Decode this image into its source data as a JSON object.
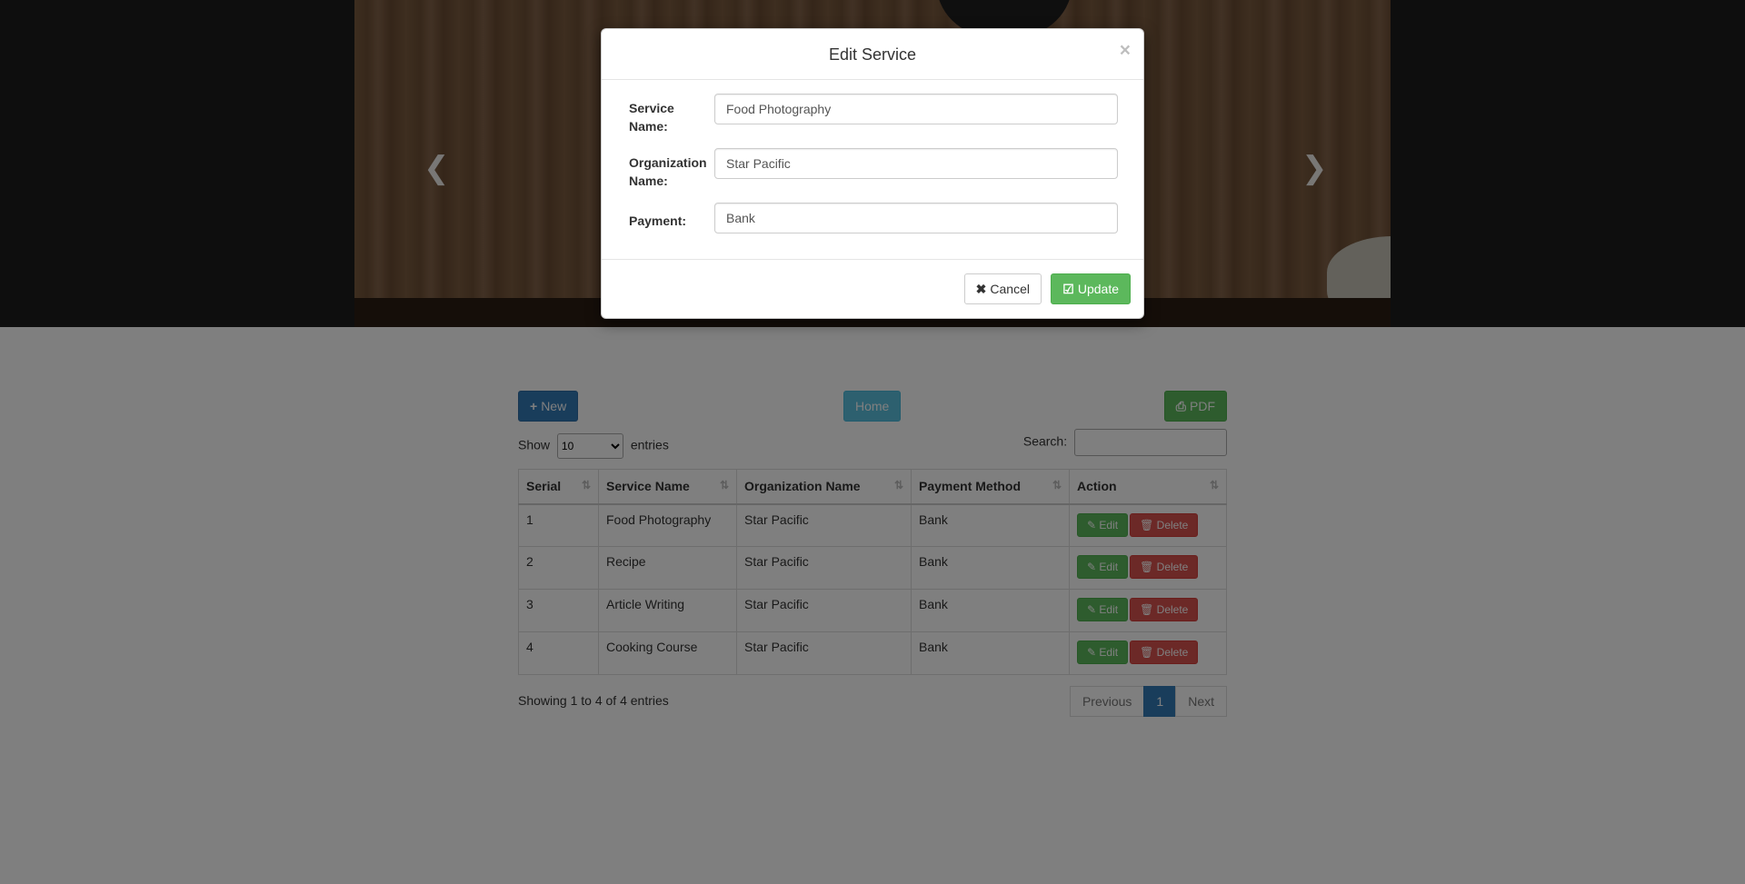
{
  "background": {
    "toolbar": {
      "new_label": "New",
      "home_label": "Home",
      "pdf_label": "PDF"
    },
    "length": {
      "show": "Show",
      "entries": "entries",
      "selected": "10"
    },
    "search_label": "Search:",
    "columns": [
      "Serial",
      "Service Name",
      "Organization Name",
      "Payment Method",
      "Action"
    ],
    "rows": [
      {
        "serial": "1",
        "service": "Food Photography",
        "org": "Star Pacific",
        "payment": "Bank"
      },
      {
        "serial": "2",
        "service": "Recipe",
        "org": "Star Pacific",
        "payment": "Bank"
      },
      {
        "serial": "3",
        "service": "Article Writing",
        "org": "Star Pacific",
        "payment": "Bank"
      },
      {
        "serial": "4",
        "service": "Cooking Course",
        "org": "Star Pacific",
        "payment": "Bank"
      }
    ],
    "row_actions": {
      "edit": "Edit",
      "delete": "Delete"
    },
    "info": "Showing 1 to 4 of 4 entries",
    "pager": {
      "previous": "Previous",
      "page": "1",
      "next": "Next"
    }
  },
  "modal": {
    "title": "Edit Service",
    "close": "×",
    "fields": {
      "service_label": "Service Name:",
      "service_value": "Food Photography",
      "org_label": "Organization Name:",
      "org_value": "Star Pacific",
      "payment_label": "Payment:",
      "payment_value": "Bank"
    },
    "cancel_label": "Cancel",
    "update_label": "Update"
  },
  "icons": {
    "plus": "plus-icon",
    "print": "print-icon",
    "times": "times-icon",
    "check": "check-square-icon",
    "edit": "edit-icon",
    "trash": "trash-icon",
    "sort": "sort-icon",
    "chevron_left": "chevron-left-icon",
    "chevron_right": "chevron-right-icon"
  },
  "colors": {
    "primary": "#337ab7",
    "success": "#5cb85c",
    "info": "#5bc0de",
    "danger": "#d9534f"
  }
}
